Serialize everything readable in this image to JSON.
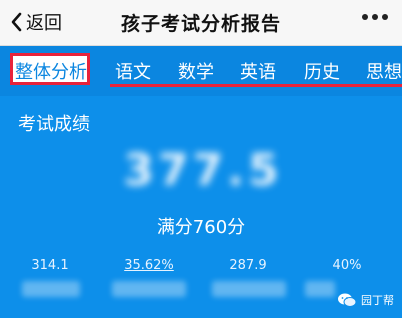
{
  "header": {
    "back_label": "返回",
    "title": "孩子考试分析报告",
    "more_icon": "more-dots-icon"
  },
  "tabs": [
    {
      "label": "整体分析",
      "active": true
    },
    {
      "label": "语文",
      "active": false
    },
    {
      "label": "数学",
      "active": false
    },
    {
      "label": "英语",
      "active": false
    },
    {
      "label": "历史",
      "active": false
    },
    {
      "label": "思想",
      "active": false
    }
  ],
  "summary": {
    "section_title": "考试成绩",
    "total_score": "377.5",
    "full_mark": "满分760分"
  },
  "stats": [
    {
      "value": "314.1",
      "underline": false
    },
    {
      "value": "35.62%",
      "underline": true
    },
    {
      "value": "287.9",
      "underline": false
    },
    {
      "value": "40%",
      "underline": false
    }
  ],
  "watermark": {
    "text": "园丁帮",
    "icon": "wechat-icon"
  },
  "colors": {
    "background": "#0d8fea",
    "highlight": "#e8233b",
    "titlebar": "#f7f7f7"
  }
}
